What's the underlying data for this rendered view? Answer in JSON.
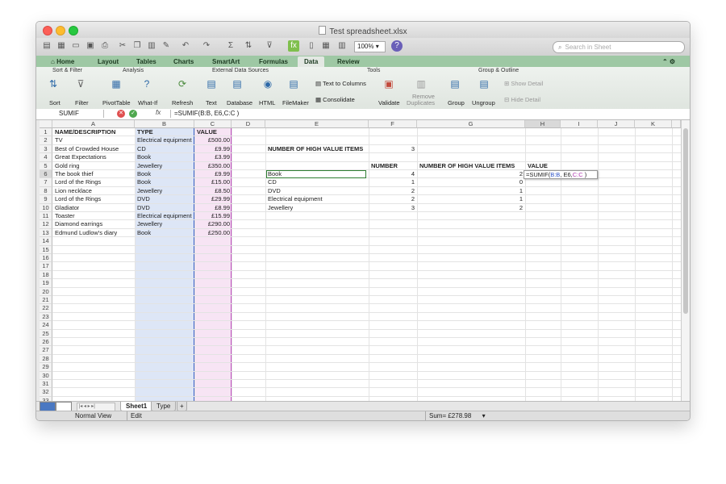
{
  "window": {
    "title": "Test spreadsheet.xlsx",
    "zoom": "100%",
    "search_placeholder": "Search in Sheet"
  },
  "ribbon": {
    "tabs": [
      "Home",
      "Layout",
      "Tables",
      "Charts",
      "SmartArt",
      "Formulas",
      "Data",
      "Review"
    ],
    "active_tab": "Data",
    "groups": [
      "Sort & Filter",
      "Analysis",
      "External Data Sources",
      "Tools",
      "Group & Outline"
    ],
    "buttons": {
      "sort": "Sort",
      "filter": "Filter",
      "pivottable": "PivotTable",
      "whatif": "What-If",
      "refresh": "Refresh",
      "text": "Text",
      "database": "Database",
      "html": "HTML",
      "filemaker": "FileMaker",
      "text_to_columns": "Text to Columns",
      "consolidate": "Consolidate",
      "validate": "Validate",
      "remove": "Remove",
      "duplicates": "Duplicates",
      "group": "Group",
      "ungroup": "Ungroup",
      "show_detail": "Show Detail",
      "hide_detail": "Hide Detail"
    }
  },
  "formula_bar": {
    "name_box": "SUMIF",
    "fx": "fx",
    "formula": "=SUMIF(B:B, E6,C:C )"
  },
  "sheet": {
    "columns": [
      "A",
      "B",
      "C",
      "D",
      "E",
      "F",
      "G",
      "H",
      "I",
      "J",
      "K"
    ],
    "row_numbers": [
      "1",
      "2",
      "3",
      "4",
      "5",
      "6",
      "7",
      "8",
      "9",
      "10",
      "11",
      "12",
      "13",
      "14",
      "15",
      "16",
      "17",
      "18",
      "19",
      "20",
      "21",
      "22",
      "23",
      "24",
      "25",
      "26",
      "27",
      "28",
      "29",
      "30",
      "31",
      "32",
      "33"
    ],
    "headers": {
      "a": "NAME/DESCRIPTION",
      "b": "TYPE",
      "c": "VALUE"
    },
    "items": [
      {
        "name": "TV",
        "type": "Electrical equipment",
        "value": "£500.00"
      },
      {
        "name": "Best of Crowded House",
        "type": "CD",
        "value": "£9.99"
      },
      {
        "name": "Great Expectations",
        "type": "Book",
        "value": "£3.99"
      },
      {
        "name": "Gold ring",
        "type": "Jewellery",
        "value": "£350.00"
      },
      {
        "name": "The book thief",
        "type": "Book",
        "value": "£9.99"
      },
      {
        "name": "Lord of the Rings",
        "type": "Book",
        "value": "£15.00"
      },
      {
        "name": "Lion necklace",
        "type": "Jewellery",
        "value": "£8.50"
      },
      {
        "name": "Lord of the Rings",
        "type": "DVD",
        "value": "£29.99"
      },
      {
        "name": "Gladiator",
        "type": "DVD",
        "value": "£8.99"
      },
      {
        "name": "Toaster",
        "type": "Electrical equipment",
        "value": "£15.99"
      },
      {
        "name": "Diamond earrings",
        "type": "Jewellery",
        "value": "£290.00"
      },
      {
        "name": "Edmund Ludlow's diary",
        "type": "Book",
        "value": "£250.00"
      }
    ],
    "high_value_label": "NUMBER OF HIGH VALUE ITEMS",
    "high_value_count": "3",
    "summary_headers": {
      "f": "NUMBER",
      "g": "NUMBER OF HIGH VALUE ITEMS",
      "h": "VALUE"
    },
    "summary": [
      {
        "type": "Book",
        "number": "4",
        "high": "2"
      },
      {
        "type": "CD",
        "number": "1",
        "high": "0"
      },
      {
        "type": "DVD",
        "number": "2",
        "high": "1"
      },
      {
        "type": "Electrical equipment",
        "number": "2",
        "high": "1"
      },
      {
        "type": "Jewellery",
        "number": "3",
        "high": "2"
      }
    ],
    "editing": {
      "prefix": "=SUMIF(",
      "ref_b": "B:B",
      "mid": ", E6,",
      "ref_c": "C:C",
      "suffix": " )"
    }
  },
  "sheet_tabs": [
    "Sheet1",
    "Type"
  ],
  "add_sheet": "+",
  "status": {
    "view": "Normal View",
    "mode": "Edit",
    "sum": "Sum= £278.98"
  }
}
